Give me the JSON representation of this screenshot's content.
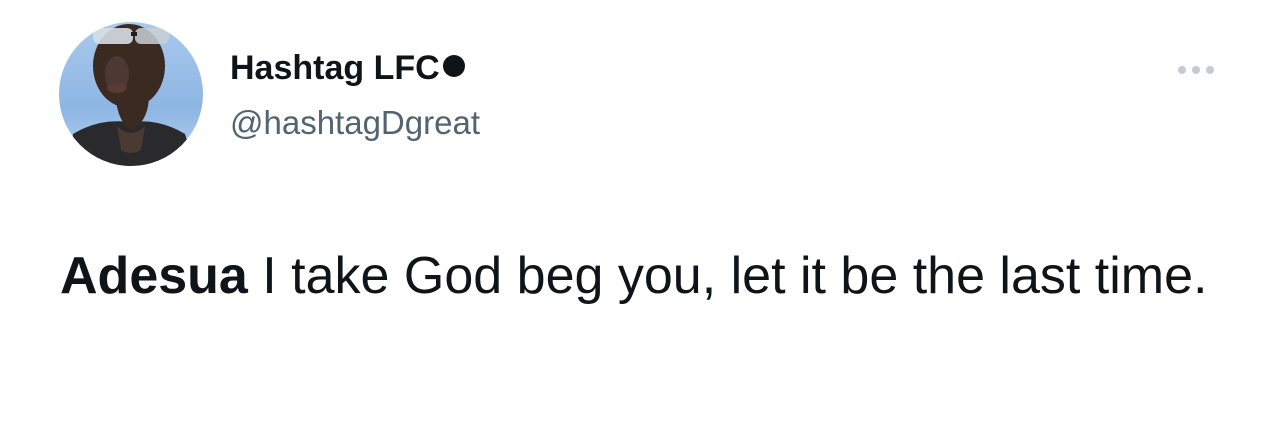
{
  "tweet": {
    "author": {
      "display_name": "Hashtag LFC",
      "name_suffix_icon": "black-circle-icon",
      "handle": "@hashtagDgreat",
      "avatar_icon": "profile-photo"
    },
    "more_icon": "more-horizontal-icon",
    "text_bold": "Adesua",
    "text_rest": " I take God beg you, let it be the last time."
  },
  "colors": {
    "primary_text": "#0f1419",
    "secondary_text": "#536471",
    "background": "#ffffff",
    "more_dots": "#c4cbd2"
  }
}
